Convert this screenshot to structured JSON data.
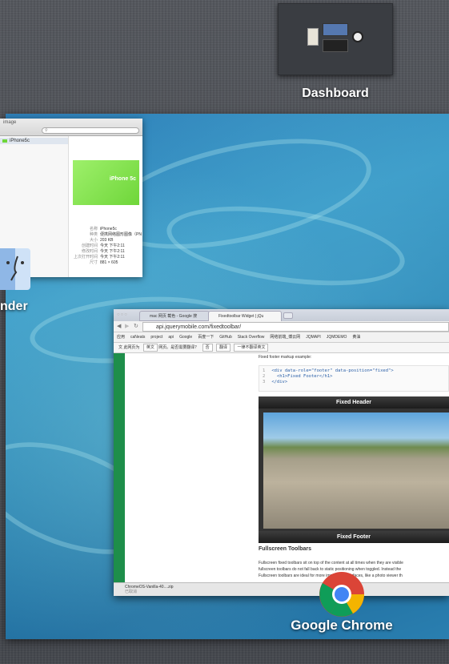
{
  "dashboard": {
    "label": "Dashboard"
  },
  "preview_window": {
    "title": "image",
    "sidebar_item": "iPhone5c",
    "product_text": "iPhone 5c",
    "info": [
      {
        "k": "名称",
        "v": "iPhone5c"
      },
      {
        "k": "种类",
        "v": "便携网络图形图像（PN"
      },
      {
        "k": "大小",
        "v": "203 KB"
      },
      {
        "k": "创建时间",
        "v": "今天 下午2:11"
      },
      {
        "k": "修改时间",
        "v": "今天 下午2:11"
      },
      {
        "k": "上次打开时间",
        "v": "今天 下午2:11"
      },
      {
        "k": "尺寸",
        "v": "881 × 605"
      }
    ]
  },
  "finder": {
    "label": "nder"
  },
  "chrome_window": {
    "tabs": [
      {
        "label": "mac 网页 截色 - Google 搜"
      },
      {
        "label": "Fixedtoolbar Widget | jQu"
      }
    ],
    "url": "api.jquerymobile.com/fixedtoolbar/",
    "bookmarks": [
      "应用",
      "caNeats",
      "project",
      "api",
      "Google",
      "百度一下",
      "GitHub",
      "Stack Overflow",
      "网络前端_博云网",
      "JQMAPI",
      "JQMDEMO",
      "黄油"
    ],
    "translate": {
      "label": "此网页为",
      "lang": "英文",
      "question": "网页。是否需要翻译？",
      "yes": "否",
      "translate_btn": "翻译",
      "never": "一律不翻译英文"
    },
    "section_intro": "Fixed footer markup example:",
    "code_lines": [
      {
        "num": "1",
        "text": "<div data-role=\"footer\" data-position=\"fixed\">"
      },
      {
        "num": "2",
        "text": "  <h1>Fixed Footer</h1>"
      },
      {
        "num": "3",
        "text": "</div>"
      }
    ],
    "demo_header": "Fixed Header",
    "demo_footer": "Fixed Footer",
    "heading": "Fullscreen Toolbars",
    "paragraph_lines": [
      "Fullscreen fixed toolbars sit on top of the content at all times when they are visible",
      "fullscreen toolbars do not fall back to static positioning when toggled. Instead the",
      "Fullscreen toolbars are ideal for more immersive interfaces, like a photo viewer th"
    ],
    "download": {
      "file": "ChromeOS-Vanilla-40....zip",
      "status": "已取消"
    }
  },
  "chrome_app": {
    "label": "Google Chrome"
  },
  "colors": {
    "desktop_blue": "#2f7fb8",
    "jqm_green": "#1e8e4a",
    "phone_green": "#9ef06b"
  }
}
